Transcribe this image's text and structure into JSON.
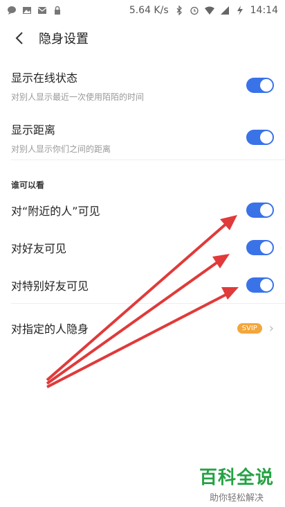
{
  "status_bar": {
    "speed": "5.64 K/s",
    "time": "14:14",
    "left_icons": [
      "chat-bubble-icon",
      "image-icon",
      "mail-icon",
      "lock-icon"
    ],
    "right_icons": [
      "bluetooth-icon",
      "alarm-icon",
      "wifi-icon",
      "signal-icon",
      "battery-charging-icon"
    ]
  },
  "nav": {
    "title": "隐身设置"
  },
  "settings": {
    "online_status": {
      "title": "显示在线状态",
      "subtitle": "对别人显示最近一次使用陌陌的时间",
      "enabled": true
    },
    "distance": {
      "title": "显示距离",
      "subtitle": "对别人显示你们之间的距离",
      "enabled": true
    }
  },
  "visibility_section": {
    "header": "谁可以看",
    "nearby": {
      "title": "对“附近的人”可见",
      "enabled": true
    },
    "friends": {
      "title": "对好友可见",
      "enabled": true
    },
    "special_friends": {
      "title": "对特别好友可见",
      "enabled": true
    },
    "hide_from": {
      "title": "对指定的人隐身",
      "badge": "SVIP"
    }
  },
  "watermark": {
    "main": "百科全说",
    "sub": "助你轻松解决"
  },
  "colors": {
    "toggle_on": "#3a72e8",
    "svip": "#f3a63b",
    "arrow": "#e03a3a",
    "watermark": "#25a244"
  }
}
